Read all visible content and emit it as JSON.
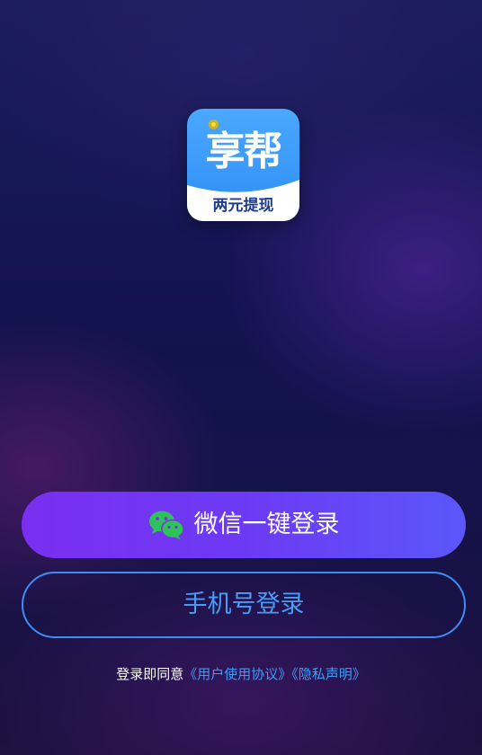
{
  "app_icon": {
    "brand": "享帮",
    "tagline": "两元提现"
  },
  "login": {
    "wechat_label": "微信一键登录",
    "phone_label": "手机号登录"
  },
  "agreement": {
    "prefix": "登录即同意",
    "user_agreement": "《用户使用协议》",
    "privacy": "《隐私声明》"
  },
  "colors": {
    "wechat_button": "#6c3af4",
    "phone_button_border": "#3a8ff5",
    "link": "#3f9cf5",
    "wechat_green": "#2fc25b",
    "icon_blue": "#3b9af8"
  },
  "icons": {
    "wechat": "wechat-icon",
    "coin": "coin-icon"
  }
}
